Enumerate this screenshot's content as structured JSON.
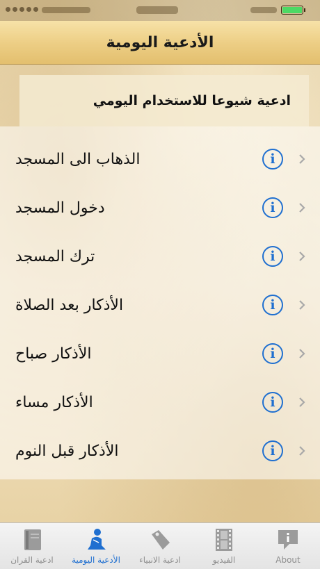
{
  "nav": {
    "title": "الأدعية اليومية"
  },
  "section": {
    "title": "ادعية شيوعا للاستخدام اليومي"
  },
  "items": [
    {
      "label": "الذهاب الى المسجد"
    },
    {
      "label": "دخول المسجد"
    },
    {
      "label": "ترك المسجد"
    },
    {
      "label": "الأذكار بعد الصلاة"
    },
    {
      "label": "الأذكار صباح"
    },
    {
      "label": "الأذكار مساء"
    },
    {
      "label": "الأذكار قبل النوم"
    }
  ],
  "tabs": [
    {
      "label": "ادعية القران",
      "icon": "book-icon"
    },
    {
      "label": "الأدعية اليومية",
      "icon": "praying-person-icon",
      "active": true
    },
    {
      "label": "ادعية الانبياء",
      "icon": "tag-icon"
    },
    {
      "label": "الفيديو",
      "icon": "film-icon"
    },
    {
      "label": "About",
      "icon": "info-bubble-icon"
    }
  ],
  "colors": {
    "accent": "#1f6fd0",
    "nav_gold": "#edcf86",
    "battery": "#4cd964"
  }
}
